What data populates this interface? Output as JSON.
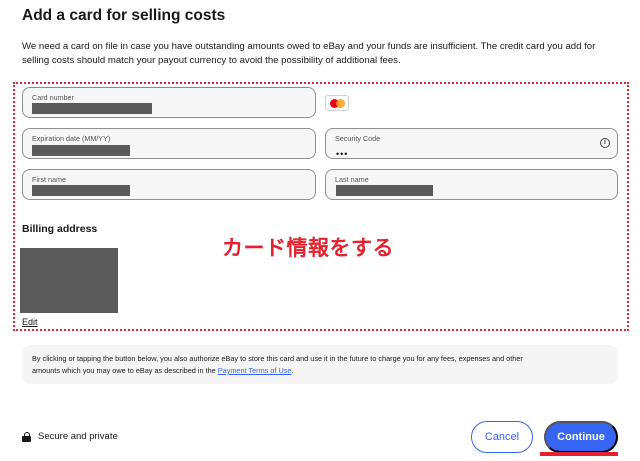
{
  "header": {
    "title": "Add a card for selling costs",
    "intro_line1": "We need a card on file in case you have outstanding amounts owed to eBay and your funds are insufficient. The credit card you add for",
    "intro_line2": "selling costs should match your payout currency to avoid the possibility of additional fees."
  },
  "form": {
    "card_number": {
      "label": "Card number",
      "value": ""
    },
    "card_brand_icon": "mastercard-icon",
    "expiration": {
      "label": "Expiration date (MM/YY)",
      "value": ""
    },
    "security_code": {
      "label": "Security Code",
      "value": "•••"
    },
    "first_name": {
      "label": "First name",
      "value": ""
    },
    "last_name": {
      "label": "Last name",
      "value": ""
    }
  },
  "billing": {
    "heading": "Billing address",
    "edit_label": "Edit"
  },
  "annotation": {
    "text": "カード情報をする",
    "color": "#e5222f"
  },
  "consent": {
    "text_line1": "By clicking or tapping the button below, you also authorize eBay to store this card and use it in the future to charge you for any fees, expenses and other",
    "text_line2_prefix": "amounts which you may owe to eBay as described in the ",
    "link_text": "Payment Terms of Use",
    "text_line2_suffix": "."
  },
  "footer": {
    "secure_label": "Secure and private",
    "cancel_label": "Cancel",
    "continue_label": "Continue"
  },
  "colors": {
    "accent": "#3665f3",
    "highlight": "#e5222f"
  }
}
